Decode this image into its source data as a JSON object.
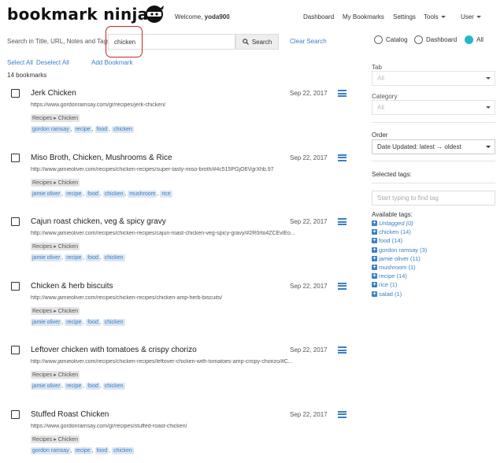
{
  "header": {
    "logo": "bookmark ninja",
    "welcome_prefix": "Welcome, ",
    "username": "yoda900",
    "nav": {
      "dashboard": "Dashboard",
      "my_bookmarks": "My Bookmarks",
      "settings": "Settings",
      "tools": "Tools",
      "user": "User"
    }
  },
  "search": {
    "label": "Search in Title, URL, Notes and Tags:",
    "value": "chicken",
    "button": "Search",
    "clear": "Clear Search"
  },
  "view": {
    "catalog": "Catalog",
    "dashboard": "Dashboard",
    "all": "All",
    "selected": "all"
  },
  "selection": {
    "select_all": "Select All",
    "deselect_all": "Deselect All",
    "add_bookmark": "Add Bookmark"
  },
  "count": "14 bookmarks",
  "bookmarks": [
    {
      "title": "Jerk Chicken",
      "url": "https://www.gordonramsay.com/gr/recipes/jerk-chicken/",
      "date": "Sep 22, 2017",
      "folder": "Recipes ▸ Chicken",
      "tags": [
        "gordon ramsay",
        "recipe",
        "food",
        "chicken"
      ]
    },
    {
      "title": "Miso Broth, Chicken, Mushrooms & Rice",
      "url": "http://www.jamieoliver.com/recipes/chicken-recipes/super-tasty-miso-broth/#4c515PGjO6VgrXhb.97",
      "date": "Sep 22, 2017",
      "folder": "Recipes ▸ Chicken",
      "tags": [
        "jamie oliver",
        "recipe",
        "food",
        "chicken",
        "mushroom",
        "rice"
      ]
    },
    {
      "title": "Cajun roast chicken, veg & spicy gravy",
      "url": "http://www.jamieoliver.com/recipes/chicken-recipes/cajun-roast-chicken-veg-spicy-gravy/#2R0rto4ZCEvlEo...",
      "date": "Sep 22, 2017",
      "folder": "Recipes ▸ Chicken",
      "tags": [
        "jamie oliver",
        "recipe",
        "food",
        "chicken"
      ]
    },
    {
      "title": "Chicken & herb biscuits",
      "url": "http://www.jamieoliver.com/recipes/chicken-recipes/chicken-amp-herb-biscuits/",
      "date": "Sep 22, 2017",
      "folder": "Recipes ▸ Chicken",
      "tags": [
        "jamie oliver",
        "recipe",
        "food",
        "chicken"
      ]
    },
    {
      "title": "Leftover chicken with tomatoes & crispy chorizo",
      "url": "http://www.jamieoliver.com/recipes/chicken-recipes/leftover-chicken-with-tomatoes-amp-crispy-chorizo/#C...",
      "date": "Sep 22, 2017",
      "folder": "Recipes ▸ Chicken",
      "tags": [
        "jamie oliver",
        "recipe",
        "food",
        "chicken"
      ]
    },
    {
      "title": "Stuffed Roast Chicken",
      "url": "https://www.gordonramsay.com/gr/recipes/stuffed-roast-chicken/",
      "date": "Sep 22, 2017",
      "folder": "Recipes ▸ Chicken",
      "tags": [
        "gordon ramsay",
        "recipe",
        "food",
        "chicken"
      ]
    }
  ],
  "sidebar": {
    "tab_label": "Tab",
    "tab_value": "All",
    "category_label": "Category",
    "category_value": "All",
    "order_label": "Order",
    "order_value": "Date Updated: latest → oldest",
    "selected_tags_label": "Selected tags:",
    "find_tag_placeholder": "Start typing to find tag",
    "available_label": "Available tags:",
    "available_tags": [
      "Untagged (0)",
      "chicken (14)",
      "food (14)",
      "gordon ramsay (3)",
      "jamie oliver (11)",
      "mushroom (1)",
      "recipe (14)",
      "rice (1)",
      "salad (1)"
    ]
  },
  "colors": {
    "link": "#3b7fc4",
    "accent": "#25b7c9",
    "tag_bg": "#dbe6f4",
    "highlight": "#cc2222"
  }
}
